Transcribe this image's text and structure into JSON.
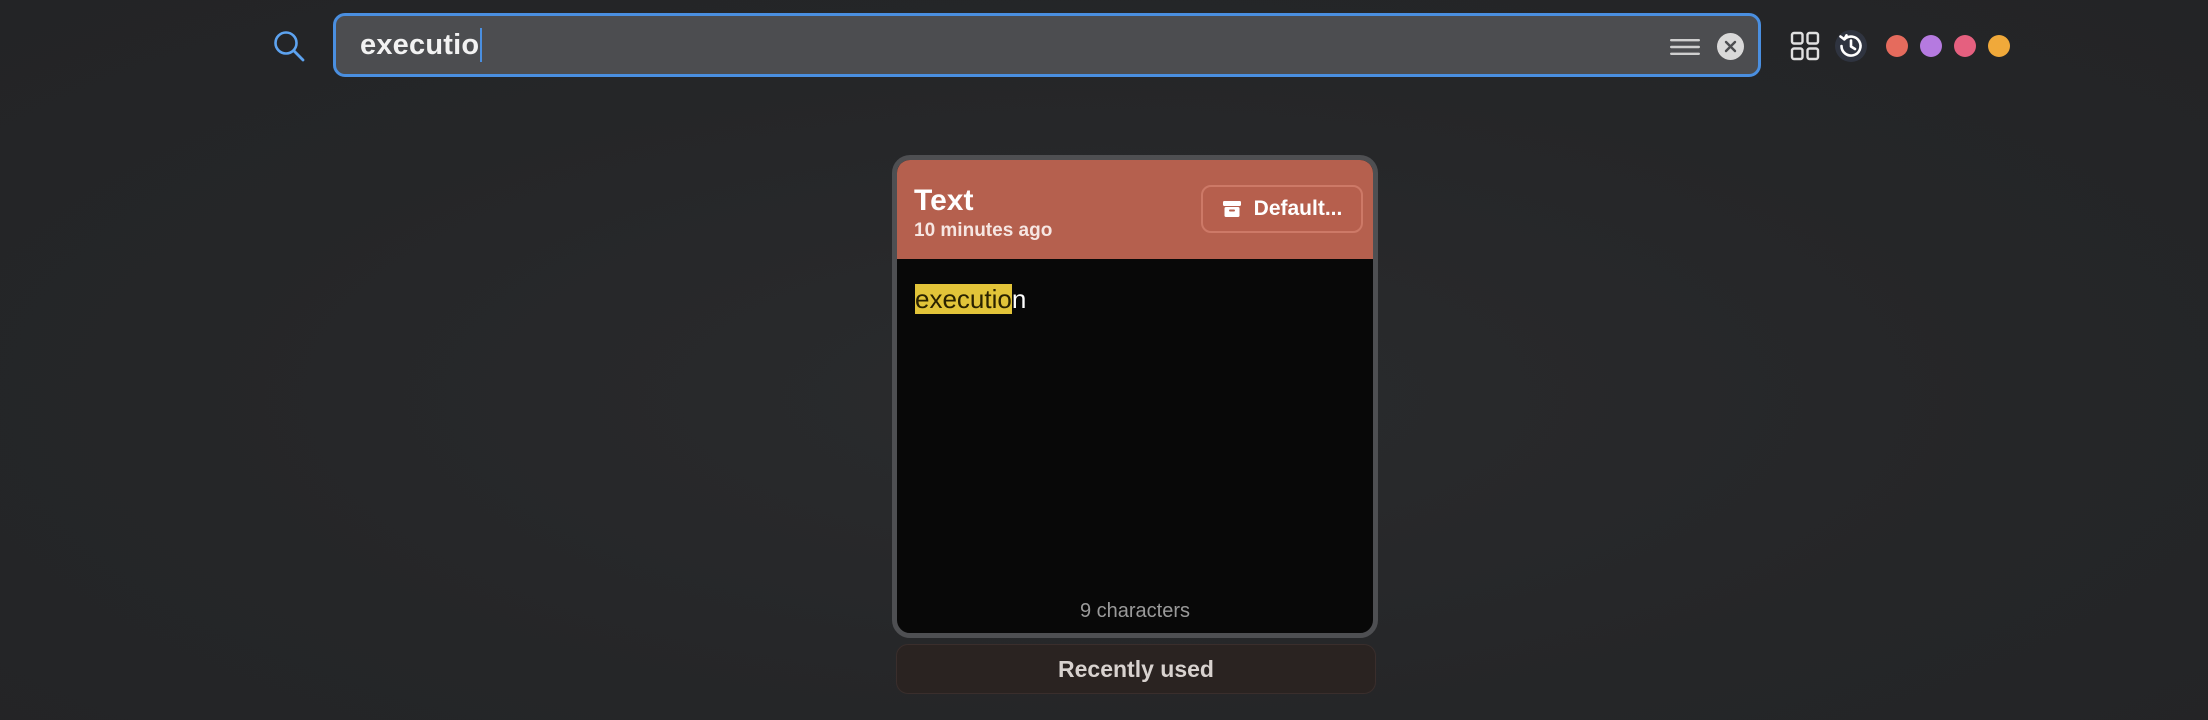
{
  "search": {
    "query": "executio"
  },
  "toolbar": {
    "color_filters": [
      {
        "color": "#e56b5d"
      },
      {
        "color": "#b57ae0"
      },
      {
        "color": "#e5607f"
      },
      {
        "color": "#f0a93a"
      }
    ]
  },
  "card": {
    "type_label": "Text",
    "timestamp": "10 minutes ago",
    "pinboard_button": "Default...",
    "header_color": "#b5604e",
    "content": {
      "match": "executio",
      "rest": "n"
    },
    "char_count": "9 characters"
  },
  "section": {
    "label": "Recently used"
  }
}
